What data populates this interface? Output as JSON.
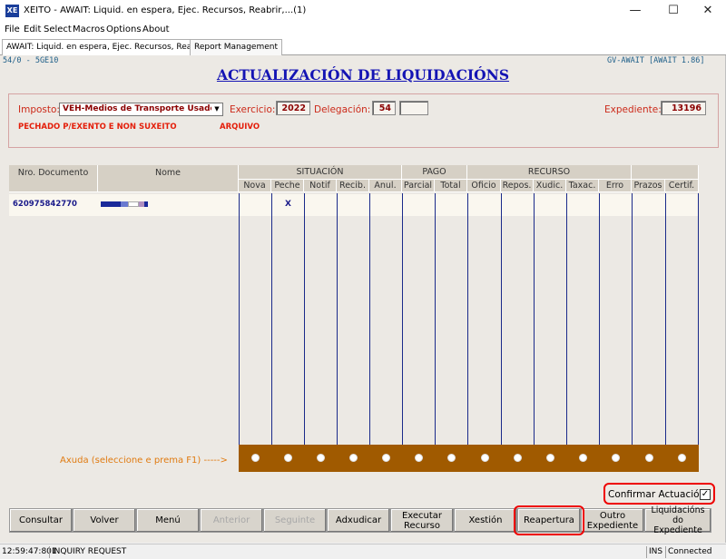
{
  "window": {
    "app_icon": "XE",
    "title": "XEITO - AWAIT: Liquid. en espera, Ejec. Recursos, Reabrir,...(1)",
    "minimize": "—",
    "maximize": "☐",
    "close": "✕"
  },
  "menu": [
    "File",
    "Edit",
    "Select",
    "Macros",
    "Options",
    "About"
  ],
  "tabs": [
    "AWAIT: Liquid. en espera, Ejec. Recursos, Reabrir,...",
    "Report Management"
  ],
  "screen": {
    "code_left": "54/0 - 5GE10",
    "code_right": "GV-AWAIT [AWAIT 1.86]",
    "title": "ACTUALIZACIÓN DE LIQUIDACIÓNS"
  },
  "header": {
    "imposto_label": "Imposto:",
    "imposto_value": "VEH-Medios de Transporte Usado",
    "dropdown_icon": "chevron-down-icon",
    "exercicio_label": "Exercicio:",
    "exercicio_value": "2022",
    "delegacion_label": "Delegación:",
    "delegacion_value": "54",
    "delegacion_extra": "",
    "expediente_label": "Expediente:",
    "expediente_value": "13196",
    "status1": "PECHADO P/EXENTO E NON SUXEITO",
    "status2": "ARQUIVO"
  },
  "grid": {
    "groups": {
      "situacion": "SITUACIÓN",
      "pago": "PAGO",
      "recurso": "RECURSO"
    },
    "columns": {
      "nro": "Nro. Documento",
      "nome": "Nome",
      "nova": "Nova",
      "peche": "Peche",
      "notif": "Notif",
      "recib": "Recib.",
      "anul": "Anul.",
      "parcial": "Parcial",
      "total": "Total",
      "oficio": "Oficio",
      "repos": "Repos.",
      "xudic": "Xudic.",
      "taxac": "Taxac.",
      "erro": "Erro",
      "prazos": "Prazos",
      "certif": "Certif."
    },
    "rows": [
      {
        "nro": "620975842770",
        "peche": "X"
      }
    ]
  },
  "help_text": "Axuda (seleccione e prema F1) ----->",
  "confirm": {
    "label": "Confirmar Actuación:",
    "mark": "✓",
    "checked": true
  },
  "buttons": {
    "consultar": "Consultar",
    "volver": "Volver",
    "menu": "Menú",
    "anterior": "Anterior",
    "seguinte": "Seguinte",
    "adxudicar": "Adxudicar",
    "executar": "Executar\nRecurso",
    "xestion": "Xestión",
    "reapertura": "Reapertura",
    "outro": "Outro\nExpediente",
    "liquidacions": "Liquidacións do\nExpediente"
  },
  "status": {
    "time": "12:59:47:801",
    "message": "INQUIRY REQUEST",
    "mode": "INS",
    "connection": "Connected"
  },
  "colors": {
    "title_blue": "#1414b4",
    "label_red": "#cc2a1a",
    "value_darkred": "#8b0000",
    "strip_brown": "#a05a00",
    "help_orange": "#e07a10",
    "highlight_red": "#e00000"
  }
}
